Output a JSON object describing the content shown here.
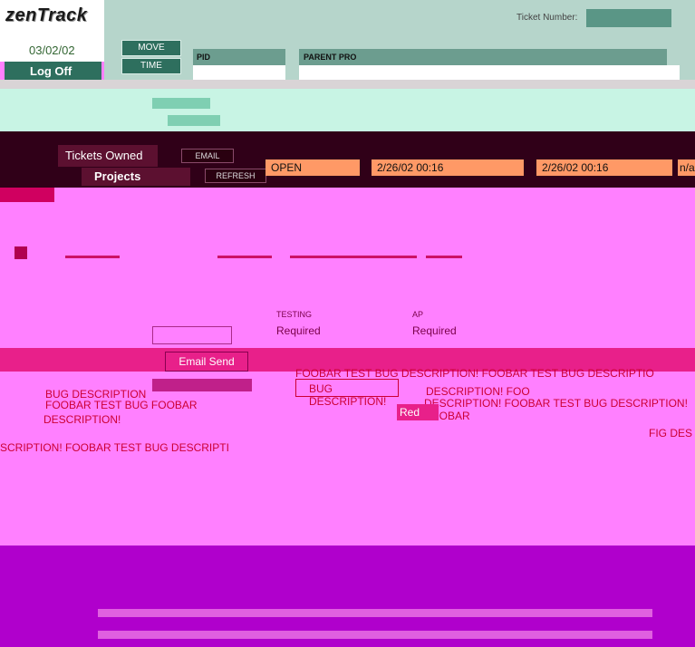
{
  "app": {
    "logo": "zenTrack",
    "date": "03/02/02",
    "logoff_label": "Log Off"
  },
  "header": {
    "ticket_number_label": "Ticket Number:",
    "ticket_number_value": ""
  },
  "actions": {
    "move_label": "MOVE",
    "time_label": "TIME"
  },
  "fields": {
    "pid_label": "PID",
    "parent_label": "PARENT PRO",
    "testing_label": "TESTING",
    "testing_value": "Required",
    "approval_label": "AP",
    "approval_value": "Required"
  },
  "nav": {
    "tickets_owned_label": "Tickets Owned",
    "projects_label": "Projects",
    "email_label": "EMAIL",
    "refresh_label": "REFRESH",
    "email_send_label": "Email Send"
  },
  "ticket_row": {
    "status": "OPEN",
    "created": "2/26/02 00:16",
    "updated": "2/26/02 00:16",
    "extra": "n/a"
  },
  "description": {
    "line1": "FOOBAR TEST BUG DESCRIPTION! FOOBAR TEST BUG DESCRIPTIO",
    "line2": "BUG DESCRIPTION!",
    "line3": "DESCRIPTION! FOO",
    "line4": "DESCRIPTION! FOOBAR TEST BUG DESCRIPTION! FOOBAR",
    "line5": "FOOBAR TEST BUG FOOBAR",
    "line6": "DESCRIPTION!",
    "line7": "BUG DESCRIPTION",
    "line8": "SCRIPTION! FOOBAR TEST BUG DESCRIPTI",
    "line9": "FIG DES",
    "red_label": "Red"
  },
  "colors": {
    "teal": "#2e6f5e",
    "panel": "#b6d5cb",
    "magenta": "#ff80ff",
    "dark": "#300018",
    "violet": "#b000cc"
  }
}
